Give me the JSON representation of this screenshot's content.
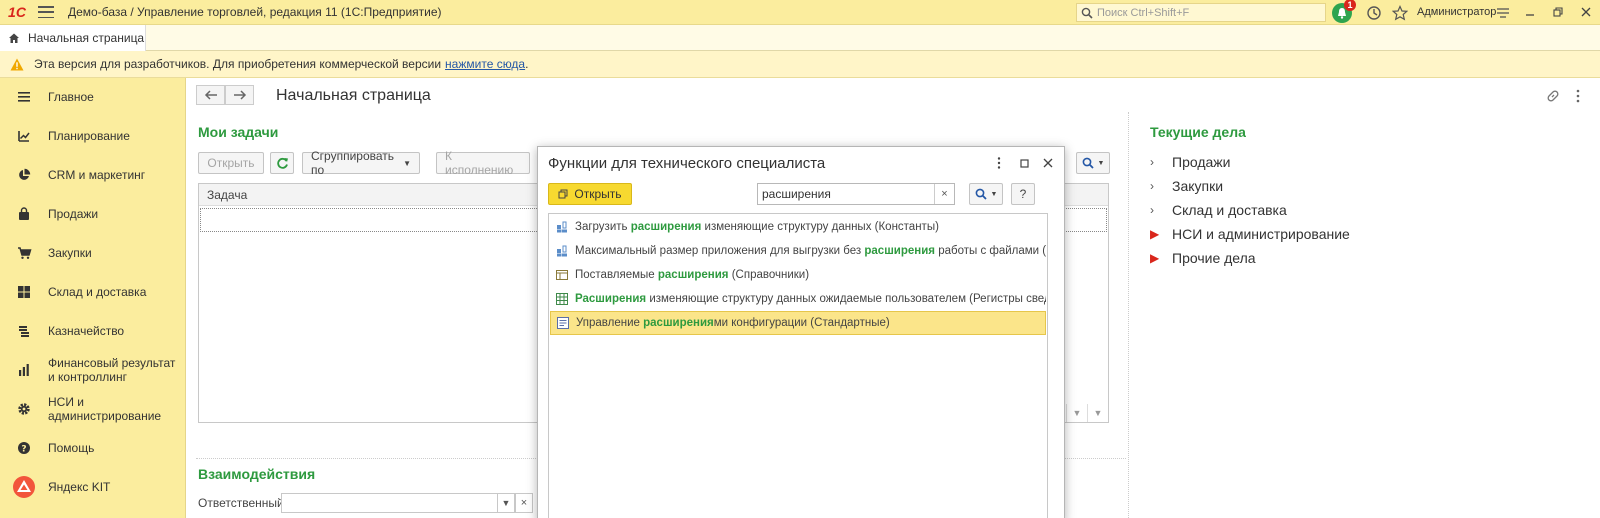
{
  "app": {
    "logo": "1С",
    "title": "Демо-база / Управление торговлей, редакция 11  (1С:Предприятие)",
    "search_placeholder": "Поиск Ctrl+Shift+F",
    "notifications_count": "1",
    "user": "Администратор"
  },
  "tabs": [
    {
      "label": "Начальная страница"
    }
  ],
  "notice": {
    "text": "Эта версия для разработчиков. Для приобретения коммерческой версии",
    "link": "нажмите сюда",
    "tail": "."
  },
  "sidebar": {
    "items": [
      {
        "label": "Главное",
        "icon": "menu-list-icon"
      },
      {
        "label": "Планирование",
        "icon": "planning-icon"
      },
      {
        "label": "CRM и маркетинг",
        "icon": "pie-chart-icon"
      },
      {
        "label": "Продажи",
        "icon": "bag-icon"
      },
      {
        "label": "Закупки",
        "icon": "cart-icon"
      },
      {
        "label": "Склад и доставка",
        "icon": "grid-icon"
      },
      {
        "label": "Казначейство",
        "icon": "coins-icon"
      },
      {
        "label": "Финансовый результат и контроллинг",
        "icon": "bar-chart-icon"
      },
      {
        "label": "НСИ и администрирование",
        "icon": "gear-icon"
      },
      {
        "label": "Помощь",
        "icon": "help-icon"
      },
      {
        "label": "Яндекс KIT",
        "icon": "yandex-kit-icon"
      }
    ]
  },
  "main": {
    "page_title": "Начальная страница",
    "my_tasks": {
      "title": "Мои задачи",
      "btn_open": "Открыть",
      "btn_group": "Сгруппировать по",
      "btn_to_exec": "К исполнению",
      "col_task": "Задача"
    },
    "interactions": {
      "title": "Взаимодействия",
      "responsible_label": "Ответственный:"
    },
    "current": {
      "title": "Текущие дела",
      "items": [
        {
          "label": "Продажи",
          "marker": "normal"
        },
        {
          "label": "Закупки",
          "marker": "normal"
        },
        {
          "label": "Склад и доставка",
          "marker": "normal"
        },
        {
          "label": "НСИ и администрирование",
          "marker": "red"
        },
        {
          "label": "Прочие дела",
          "marker": "red"
        }
      ]
    }
  },
  "dialog": {
    "title": "Функции для технического специалиста",
    "open_btn": "Открыть",
    "search_value": "расширения",
    "help_btn": "?",
    "items": [
      {
        "pre": "Загрузить ",
        "hl": "расширения",
        "post": " изменяющие структуру данных (Константы)",
        "icon": "constants-icon"
      },
      {
        "pre": "Максимальный размер приложения для выгрузки без ",
        "hl": "расширения",
        "post": " работы с файлами (М...",
        "icon": "constants-icon"
      },
      {
        "pre": "Поставляемые ",
        "hl": "расширения",
        "post": " (Справочники)",
        "icon": "catalog-icon"
      },
      {
        "pre": "",
        "hl": "Расширения",
        "post": " изменяющие структуру данных ожидаемые пользователем (Регистры свед...",
        "icon": "register-icon"
      },
      {
        "pre": "Управление ",
        "hl": "расширения",
        "post": "ми конфигурации (Стандартные)",
        "icon": "standard-icon",
        "selected": true
      }
    ]
  },
  "colors": {
    "accent_green": "#2e9a3f",
    "topbar_bg": "#fbed9e",
    "open_button": "#f7d930",
    "selection": "#fbe58a",
    "alert_red": "#d9261c"
  }
}
